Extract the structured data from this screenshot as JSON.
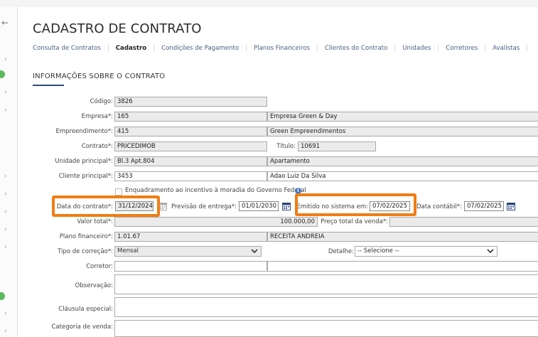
{
  "sidebar": {
    "back_icon": "←",
    "chevron_icon": "›"
  },
  "page_title": "CADASTRO DE CONTRATO",
  "tabs": [
    {
      "label": "Consulta de Contratos"
    },
    {
      "label": "Cadastro",
      "active": true
    },
    {
      "label": "Condições de Pagamento"
    },
    {
      "label": "Planos Financeiros"
    },
    {
      "label": "Clientes do Contrato"
    },
    {
      "label": "Unidades"
    },
    {
      "label": "Corretores"
    },
    {
      "label": "Avalistas"
    }
  ],
  "section_title": "INFORMAÇÕES SOBRE O CONTRATO",
  "form": {
    "codigo_label": "Código:",
    "codigo": "3826",
    "empresa_label": "Empresa*:",
    "empresa_code": "165",
    "empresa_name": "Empresa Green & Day",
    "empreendimento_label": "Empreendimento*:",
    "empreendimento_code": "415",
    "empreendimento_name": "Green Empreendimentos",
    "contrato_label": "Contrato*:",
    "contrato": "PRICEDIMOB",
    "titulo_label": "Título:",
    "titulo": "10691",
    "unidade_label": "Unidade principal*:",
    "unidade": "Bl.3 Apt.804",
    "unidade_tipo": "Apartamento",
    "cliente_label": "Cliente principal*:",
    "cliente_code": "3453",
    "cliente_name": "Adao Luiz Da Silva",
    "enquadramento_label": "Enquadramento ao incentivo à moradia do Governo Federal",
    "data_contrato_label": "Data do contrato*:",
    "data_contrato": "31/12/2024",
    "previsao_label": "Previsão de entrega*:",
    "previsao": "01/01/2030",
    "emitido_label": "Emitido no sistema em:",
    "emitido": "07/02/2025",
    "data_contabil_label": "Data contábil*:",
    "data_contabil": "07/02/2025",
    "valor_total_label": "Valor total*:",
    "valor_total": "100.000,00",
    "preco_venda_label": "Preço total da venda*:",
    "preco_venda": "",
    "plano_label": "Plano financeiro*:",
    "plano_code": "1.01.67",
    "plano_name": "RECEITA ANDREIA",
    "correcao_label": "Tipo de correção*:",
    "correcao": "Mensal",
    "detalhe_label": "Detalhe:",
    "detalhe": "-- Selecione --",
    "corretor_label": "Corretor:",
    "observacao_label": "Observação:",
    "clausula_label": "Cláusula especial:",
    "categoria_label": "Categoria de venda:"
  },
  "colors": {
    "highlight": "#f07d12",
    "accent": "#2f4a7a",
    "sidebar_dot": "#5cb85c"
  }
}
